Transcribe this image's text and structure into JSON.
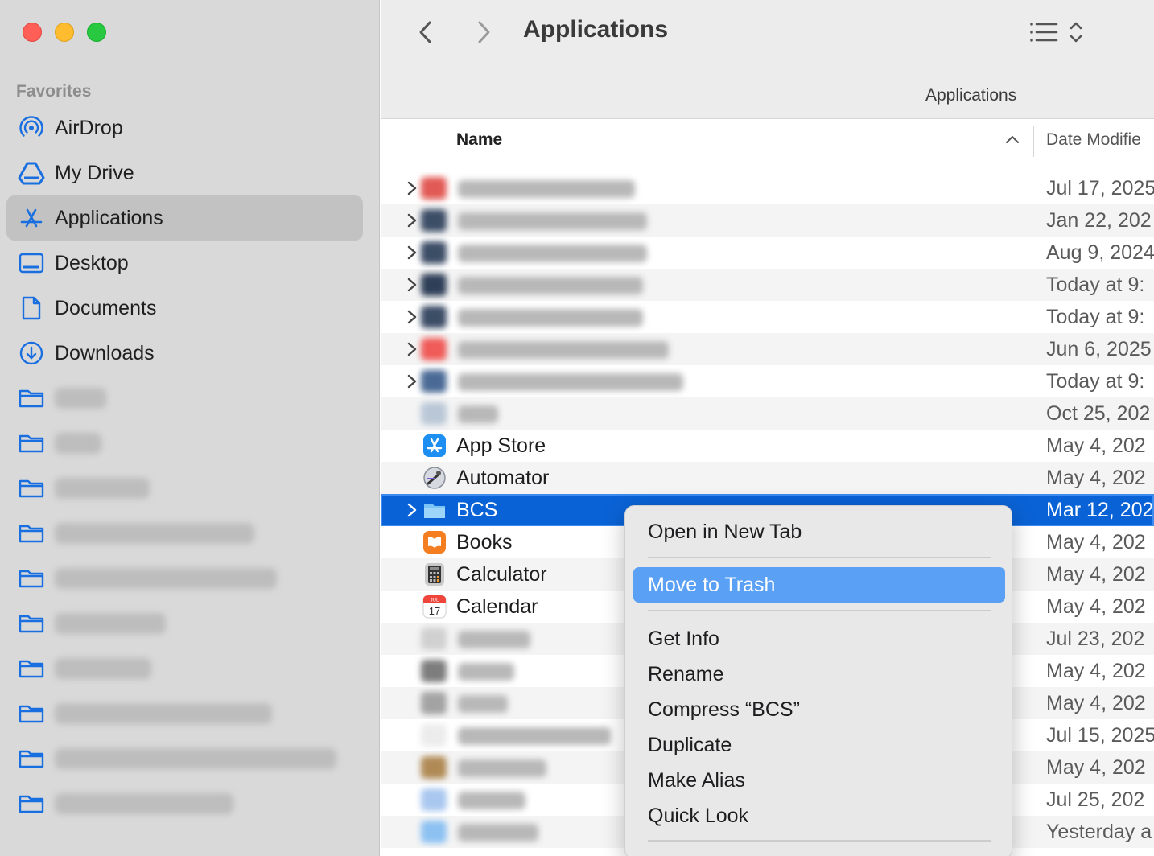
{
  "window": {
    "title": "Applications",
    "path_label": "Applications"
  },
  "sidebar": {
    "section_label": "Favorites",
    "items": [
      {
        "label": "AirDrop",
        "icon": "airdrop-icon",
        "selected": false
      },
      {
        "label": "My Drive",
        "icon": "drive-icon",
        "selected": false
      },
      {
        "label": "Applications",
        "icon": "applications-icon",
        "selected": true
      },
      {
        "label": "Desktop",
        "icon": "desktop-icon",
        "selected": false
      },
      {
        "label": "Documents",
        "icon": "document-icon",
        "selected": false
      },
      {
        "label": "Downloads",
        "icon": "download-icon",
        "selected": false
      }
    ],
    "blurred_folders": 10
  },
  "columns": {
    "name": "Name",
    "date": "Date Modifie"
  },
  "files": [
    {
      "name": "",
      "date": "Jul 17, 2025",
      "blurred": true,
      "disclosure": true
    },
    {
      "name": "",
      "date": "Jan 22, 202",
      "blurred": true,
      "disclosure": true
    },
    {
      "name": "",
      "date": "Aug 9, 2024",
      "blurred": true,
      "disclosure": true
    },
    {
      "name": "",
      "date": "Today at 9:",
      "blurred": true,
      "disclosure": true
    },
    {
      "name": "",
      "date": "Today at 9:",
      "blurred": true,
      "disclosure": true
    },
    {
      "name": "",
      "date": "Jun 6, 2025",
      "blurred": true,
      "disclosure": true
    },
    {
      "name": "",
      "date": "Today at 9:",
      "blurred": true,
      "disclosure": true
    },
    {
      "name": "",
      "date": "Oct 25, 202",
      "blurred": true,
      "disclosure": false
    },
    {
      "name": "App Store",
      "date": "May 4, 202",
      "icon": "app-store-icon"
    },
    {
      "name": "Automator",
      "date": "May 4, 202",
      "icon": "automator-icon"
    },
    {
      "name": "BCS",
      "date": "Mar 12, 202",
      "icon": "folder-icon",
      "selected": true,
      "disclosure": true
    },
    {
      "name": "Books",
      "date": "May 4, 202",
      "icon": "books-icon"
    },
    {
      "name": "Calculator",
      "date": "May 4, 202",
      "icon": "calculator-icon"
    },
    {
      "name": "Calendar",
      "date": "May 4, 202",
      "icon": "calendar-icon",
      "calendar_day": "17",
      "calendar_month": "JUL"
    },
    {
      "name": "",
      "date": "Jul 23, 202",
      "blurred": true
    },
    {
      "name": "",
      "date": "May 4, 202",
      "blurred": true
    },
    {
      "name": "",
      "date": "May 4, 202",
      "blurred": true
    },
    {
      "name": "",
      "date": "Jul 15, 2025",
      "blurred": true
    },
    {
      "name": "",
      "date": "May 4, 202",
      "blurred": true
    },
    {
      "name": "",
      "date": "Jul 25, 202",
      "blurred": true
    },
    {
      "name": "",
      "date": "Yesterday a",
      "blurred": true
    }
  ],
  "context_menu": {
    "items": [
      {
        "label": "Open in New Tab"
      },
      {
        "label": "Move to Trash",
        "highlighted": true
      },
      {
        "label": "Get Info"
      },
      {
        "label": "Rename"
      },
      {
        "label": "Compress “BCS”"
      },
      {
        "label": "Duplicate"
      },
      {
        "label": "Make Alias"
      },
      {
        "label": "Quick Look"
      }
    ]
  },
  "colors": {
    "accent": "#0a63d6",
    "menu_highlight": "#5aa0f5",
    "sidebar_icon": "#1a6fe0"
  }
}
